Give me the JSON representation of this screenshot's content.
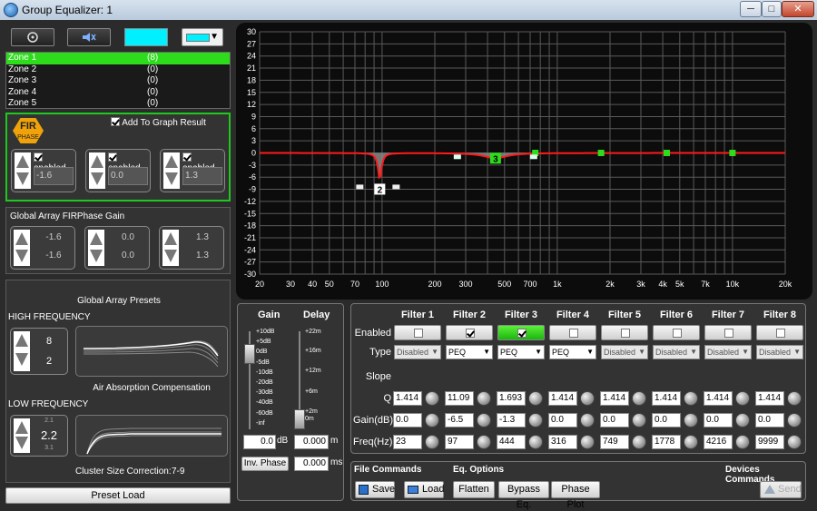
{
  "window": {
    "title": "Group Equalizer: 1",
    "min_glyph": "─",
    "max_glyph": "□",
    "close_glyph": "✕"
  },
  "colors": {
    "accent_green": "#2ddd1c",
    "swatch_cyan": "#00f0ff",
    "curve_red": "#ff1a1a"
  },
  "zones": [
    {
      "name": "Zone 1",
      "count": "(8)"
    },
    {
      "name": "Zone 2",
      "count": "(0)"
    },
    {
      "name": "Zone 3",
      "count": "(0)"
    },
    {
      "name": "Zone 4",
      "count": "(0)"
    },
    {
      "name": "Zone 5",
      "count": "(0)"
    }
  ],
  "fir": {
    "logo_top": "FIR",
    "logo_bottom": "PHASE",
    "add_to_graph": "Add To Graph Result",
    "enabled_label": "enabled",
    "values": [
      "-1.6",
      "0.0",
      "1.3"
    ]
  },
  "global_gain": {
    "label": "Global Array FIRPhase Gain",
    "pairs": [
      [
        "-1.6",
        "-1.6"
      ],
      [
        "0.0",
        "0.0"
      ],
      [
        "1.3",
        "1.3"
      ]
    ]
  },
  "presets": {
    "label": "Global Array Presets",
    "high_label": "HIGH FREQUENCY",
    "high_values": [
      "8",
      "2"
    ],
    "air_label": "Air Absorption Compensation",
    "low_label": "LOW FREQUENCY",
    "low_small_top": "2.1",
    "low_value": "2.2",
    "low_small_bottom": "3.1",
    "cluster_label": "Cluster Size Correction:",
    "cluster_value": "7-9",
    "preset_load": "Preset Load"
  },
  "graph": {
    "y_ticks": [
      "30",
      "27",
      "24",
      "21",
      "18",
      "15",
      "12",
      "9",
      "6",
      "3",
      "0",
      "-3",
      "-6",
      "-9",
      "-12",
      "-15",
      "-18",
      "-21",
      "-24",
      "-27",
      "-30"
    ],
    "x_ticks": [
      "20",
      "30",
      "40",
      "50",
      "70",
      "100",
      "200",
      "300",
      "500",
      "700",
      "1k",
      "2k",
      "3k",
      "4k",
      "5k",
      "7k",
      "10k",
      "20k"
    ],
    "x_tick_freqs": [
      20,
      30,
      40,
      50,
      70,
      100,
      200,
      300,
      500,
      700,
      1000,
      2000,
      3000,
      4000,
      5000,
      7000,
      10000,
      20000
    ],
    "marker_2": "2",
    "marker_3": "3"
  },
  "gain_delay": {
    "gain_label": "Gain",
    "delay_label": "Delay",
    "gain_scale": [
      "+10dB",
      "+5dB",
      "0dB",
      "-5dB",
      "-10dB",
      "-20dB",
      "-30dB",
      "-40dB",
      "-60dB",
      "-inf"
    ],
    "delay_scale": [
      "+22m",
      "+16m",
      "+12m",
      "+6m",
      "+2m",
      "0m"
    ],
    "gain_value": "0.0",
    "gain_unit": "dB",
    "delay_value": "0.000",
    "delay_unit": "m",
    "inv_phase": "Inv. Phase",
    "ms_value": "0.000",
    "ms_unit": "ms"
  },
  "filters": {
    "labels": {
      "enabled": "Enabled",
      "type": "Type",
      "slope": "Slope",
      "q": "Q",
      "gain": "Gain(dB)",
      "freq": "Freq(Hz)"
    },
    "list": [
      {
        "name": "Filter 1",
        "enabled": false,
        "type": "Disabled",
        "q": "1.414",
        "gain": "0.0",
        "freq": "23"
      },
      {
        "name": "Filter 2",
        "enabled": true,
        "type": "PEQ",
        "q": "11.09",
        "gain": "-6.5",
        "freq": "97"
      },
      {
        "name": "Filter 3",
        "enabled": true,
        "type": "PEQ",
        "q": "1.693",
        "gain": "-1.3",
        "freq": "444"
      },
      {
        "name": "Filter 4",
        "enabled": false,
        "type": "PEQ",
        "q": "1.414",
        "gain": "0.0",
        "freq": "316"
      },
      {
        "name": "Filter 5",
        "enabled": false,
        "type": "Disabled",
        "q": "1.414",
        "gain": "0.0",
        "freq": "749"
      },
      {
        "name": "Filter 6",
        "enabled": false,
        "type": "Disabled",
        "q": "1.414",
        "gain": "0.0",
        "freq": "1778"
      },
      {
        "name": "Filter 7",
        "enabled": false,
        "type": "Disabled",
        "q": "1.414",
        "gain": "0.0",
        "freq": "4216"
      },
      {
        "name": "Filter 8",
        "enabled": false,
        "type": "Disabled",
        "q": "1.414",
        "gain": "0.0",
        "freq": "9999"
      }
    ]
  },
  "commands": {
    "file_label": "File Commands",
    "eq_label": "Eq. Options",
    "devices_label": "Devices Commands",
    "save": "Save",
    "load": "Load",
    "flatten": "Flatten",
    "bypass": "Bypass Eq.",
    "phase_plot": "Phase Plot",
    "send": "Send"
  }
}
